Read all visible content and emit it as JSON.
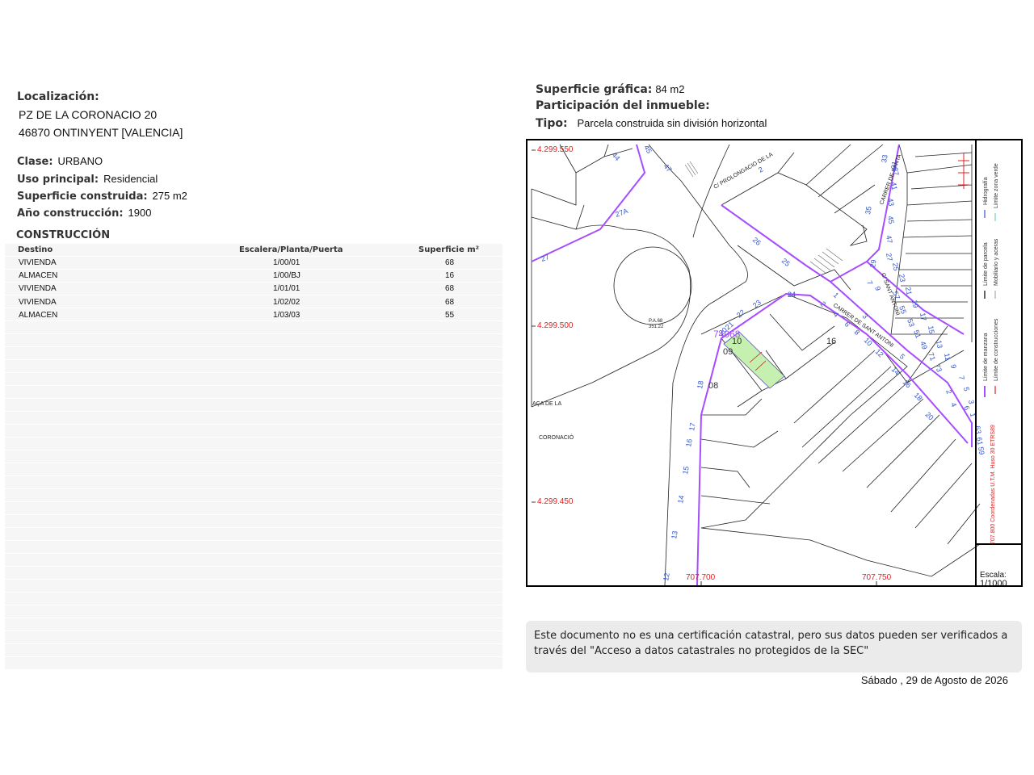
{
  "localizacion": {
    "label": "Localización:",
    "line1": "PZ DE LA CORONACIO 20",
    "line2": "46870 ONTINYENT [VALENCIA]"
  },
  "clase": {
    "label": "Clase:",
    "value": "URBANO"
  },
  "uso": {
    "label": "Uso principal:",
    "value": "Residencial"
  },
  "superficie_construida": {
    "label": "Superficie construida:",
    "value": "275 m2"
  },
  "anio": {
    "label": "Año construcción:",
    "value": "1900"
  },
  "construccion": {
    "title": "CONSTRUCCIÓN",
    "headers": [
      "Destino",
      "Escalera/Planta/Puerta",
      "Superficie m²"
    ],
    "rows": [
      [
        "VIVIENDA",
        "1/00/01",
        "68"
      ],
      [
        "ALMACEN",
        "1/00/BJ",
        "16"
      ],
      [
        "VIVIENDA",
        "1/01/01",
        "68"
      ],
      [
        "VIVIENDA",
        "1/02/02",
        "68"
      ],
      [
        "ALMACEN",
        "1/03/03",
        "55"
      ]
    ]
  },
  "superficie_grafica": {
    "label": "Superficie gráfica:",
    "value": "84 m2"
  },
  "participacion": {
    "label": "Participación del inmueble:"
  },
  "tipo": {
    "label": "Tipo:",
    "value": "Parcela construida sin división horizontal"
  },
  "mapa": {
    "coords_y": [
      "4.299.550",
      "4.299.500",
      "4.299.450"
    ],
    "coords_x": [
      "707.700",
      "707.750"
    ],
    "calles": [
      "C/ PROLONGACIO DE LA",
      "CARRER DE SANT ANTONI",
      "CARRER DE SANTA",
      "C/ SANT ANTONI"
    ],
    "plaza": [
      "AÇA DE LA",
      "CORONACIÓ"
    ],
    "pa_label": [
      "P.A.68",
      "351.22"
    ],
    "manzana": "74068",
    "parcelas": [
      "10",
      "09",
      "08",
      "16"
    ],
    "numeros": [
      "44",
      "45",
      "47",
      "2",
      "27A",
      "26",
      "25",
      "24",
      "27",
      "22",
      "23",
      "21",
      "20",
      "18",
      "17",
      "16",
      "15",
      "14",
      "13",
      "12",
      "2",
      "4",
      "6",
      "8",
      "10",
      "12",
      "14",
      "16",
      "18",
      "20",
      "1",
      "3",
      "5",
      "7",
      "9",
      "47",
      "45",
      "43",
      "41",
      "37",
      "35",
      "33",
      "31",
      "29",
      "27",
      "25",
      "23",
      "21",
      "19",
      "17",
      "15",
      "13",
      "11",
      "9",
      "7",
      "5",
      "3",
      "1",
      "63",
      "61",
      "59",
      "57",
      "55",
      "53",
      "51",
      "49",
      "71",
      "73",
      "2",
      "4",
      "6"
    ],
    "leyenda": {
      "hidrografia": "Hidrografía",
      "limite_zona_verde": "Límite zona verde",
      "limite_parcela": "Límite de parcela",
      "mobiliario": "Mobiliario y aceras",
      "limite_manzana": "Límite de manzana",
      "limite_construcciones": "Límite de construcciones",
      "coordenadas": "707.800 Coordenadas U.T.M. Huso 30 ETRS89"
    },
    "escala_label": "Escala:",
    "escala_value": "1/1000"
  },
  "nota": "Este documento no es una certificación catastral, pero sus datos pueden ser verificados a través del \"Acceso a datos catastrales no protegidos de la SEC\"",
  "fecha": "Sábado , 29 de Agosto de 2026",
  "colors": {
    "coord_red": "#e02020",
    "street_purple": "#a64dff",
    "parcel_green": "#c6f0b0"
  }
}
